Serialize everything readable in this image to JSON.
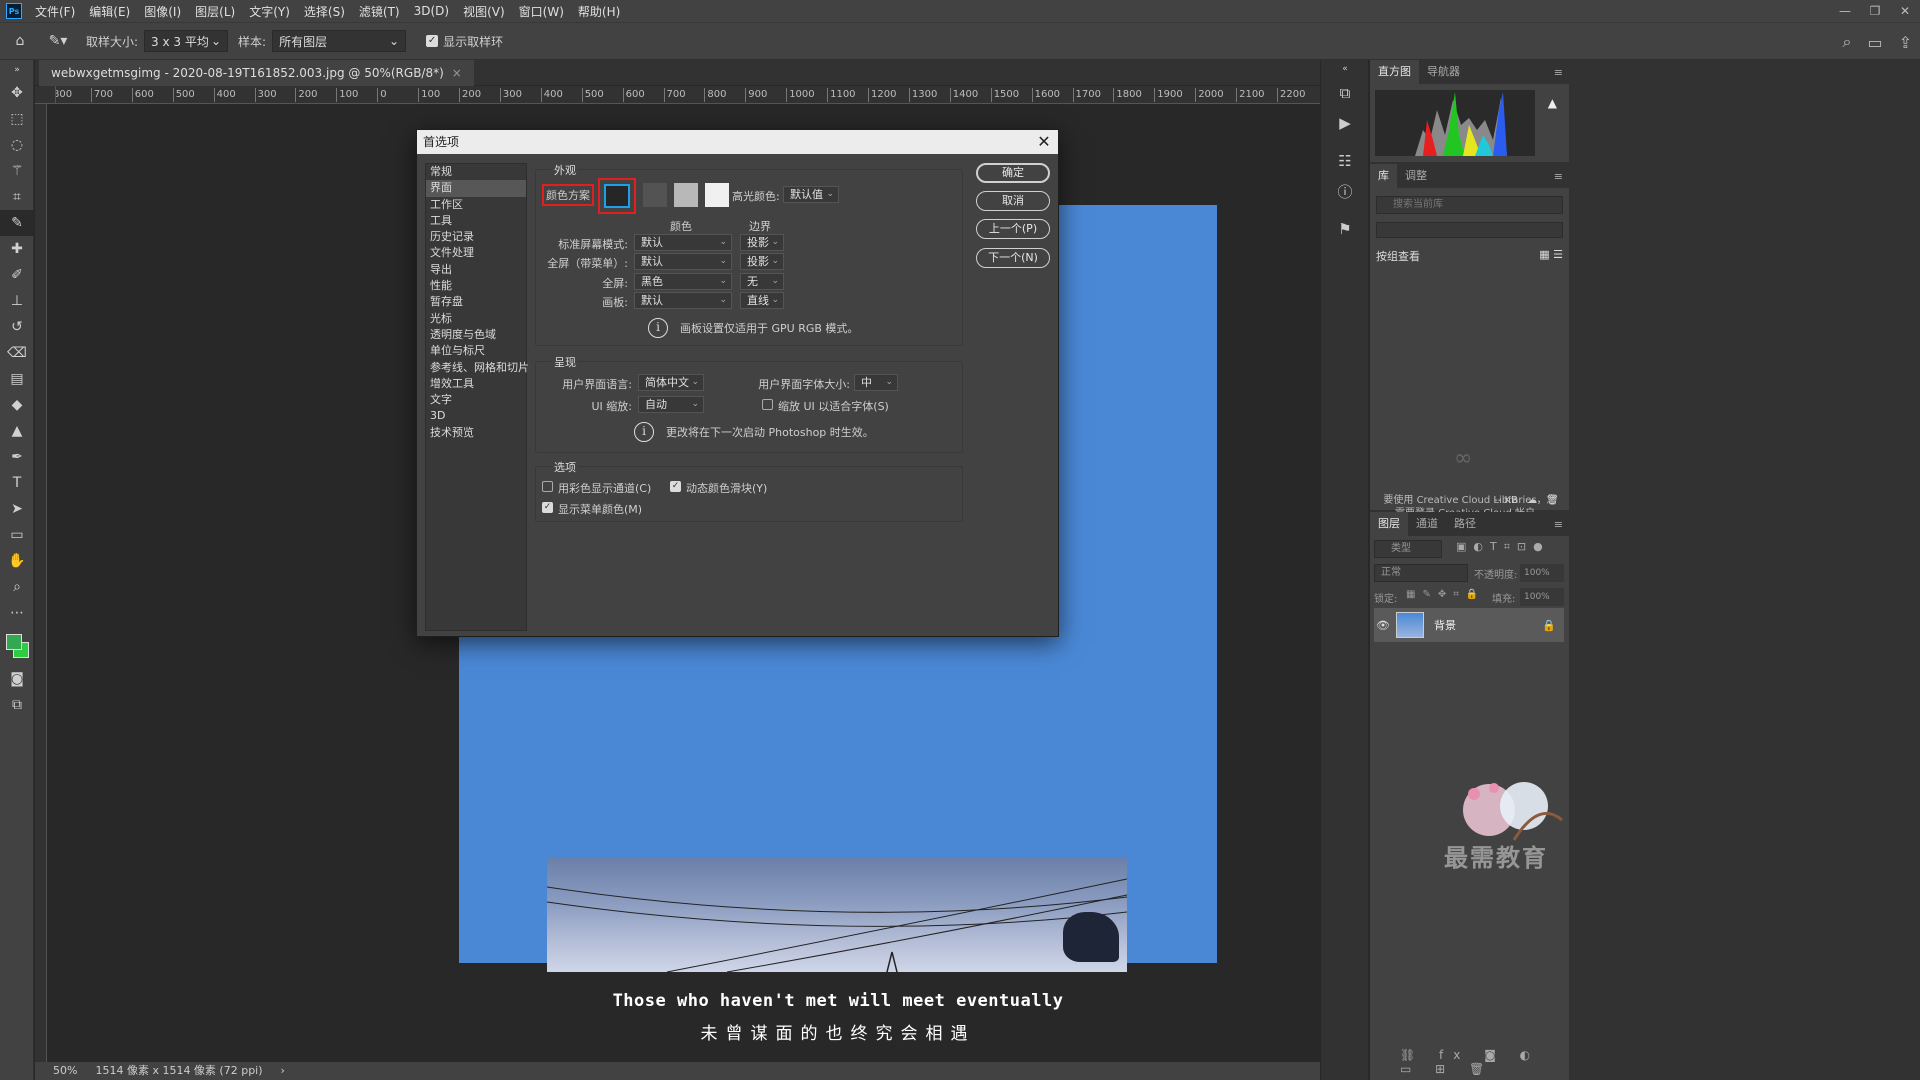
{
  "menubar": {
    "logo": "Ps",
    "items": [
      "文件(F)",
      "编辑(E)",
      "图像(I)",
      "图层(L)",
      "文字(Y)",
      "选择(S)",
      "滤镜(T)",
      "3D(D)",
      "视图(V)",
      "窗口(W)",
      "帮助(H)"
    ]
  },
  "options": {
    "sample_size_label": "取样大小:",
    "sample_size_value": "3 x 3 平均",
    "sample_label": "样本:",
    "sample_value": "所有图层",
    "show_ring_label": "显示取样环"
  },
  "document": {
    "tab_title": "webwxgetmsgimg - 2020-08-19T161852.003.jpg @ 50%(RGB/8*)",
    "ruler_ticks": [
      "800",
      "700",
      "600",
      "500",
      "400",
      "300",
      "200",
      "100",
      "0",
      "100",
      "200",
      "300",
      "400",
      "500",
      "600",
      "700",
      "800",
      "900",
      "1000",
      "1100",
      "1200",
      "1300",
      "1400",
      "1500",
      "1600",
      "1700",
      "1800",
      "1900",
      "2000",
      "2100",
      "2200"
    ],
    "image_text_en": "Those who haven't met will meet eventually",
    "image_text_cn": "未曾谋面的也终究会相遇",
    "status_zoom": "50%",
    "status_size": "1514 像素 x 1514 像素 (72 ppi)"
  },
  "panels": {
    "top_tabs": [
      "直方图",
      "导航器"
    ],
    "lib_tabs": [
      "库",
      "调整"
    ],
    "lib_search_placeholder": "搜索当前库",
    "lib_view": "按组查看",
    "lib_msg": "要使用 Creative Cloud Libraries，您需要登录 Creative Cloud 帐户。",
    "lib_size": "-- KB",
    "layer_tabs": [
      "图层",
      "通道",
      "路径"
    ],
    "layer_filter": "类型",
    "blend_mode": "正常",
    "opacity_label": "不透明度:",
    "opacity_value": "100%",
    "lock_label": "锁定:",
    "fill_label": "填充:",
    "fill_value": "100%",
    "layer_name": "背景"
  },
  "dialog": {
    "title": "首选项",
    "categories": [
      "常规",
      "界面",
      "工作区",
      "工具",
      "历史记录",
      "文件处理",
      "导出",
      "性能",
      "暂存盘",
      "光标",
      "透明度与色域",
      "单位与标尺",
      "参考线、网格和切片",
      "增效工具",
      "文字",
      "3D",
      "技术预览"
    ],
    "selected_category": 1,
    "appearance": {
      "group_title": "外观",
      "color_scheme_label": "颜色方案",
      "swatches": [
        "#262626",
        "#535353",
        "#b8b8b8",
        "#f0f0f0"
      ],
      "highlight_label": "高光颜色:",
      "highlight_value": "默认值",
      "col_color": "颜色",
      "col_border": "边界",
      "rows": [
        {
          "label": "标准屏幕模式:",
          "color": "默认",
          "border": "投影"
        },
        {
          "label": "全屏（带菜单）:",
          "color": "默认",
          "border": "投影"
        },
        {
          "label": "全屏:",
          "color": "黑色",
          "border": "无"
        },
        {
          "label": "画板:",
          "color": "默认",
          "border": "直线"
        }
      ],
      "note": "画板设置仅适用于 GPU RGB 模式。"
    },
    "presentation": {
      "group_title": "呈现",
      "lang_label": "用户界面语言:",
      "lang_value": "简体中文",
      "fontsize_label": "用户界面字体大小:",
      "fontsize_value": "中",
      "scale_label": "UI 缩放:",
      "scale_value": "自动",
      "scale_fit_label": "缩放 UI 以适合字体(S)",
      "note": "更改将在下一次启动 Photoshop 时生效。"
    },
    "options": {
      "group_title": "选项",
      "color_channels": "用彩色显示通道(C)",
      "dynamic_sliders": "动态颜色滑块(Y)",
      "menu_colors": "显示菜单颜色(M)"
    },
    "buttons": {
      "ok": "确定",
      "cancel": "取消",
      "prev": "上一个(P)",
      "next": "下一个(N)"
    }
  },
  "watermark": "最需教育"
}
